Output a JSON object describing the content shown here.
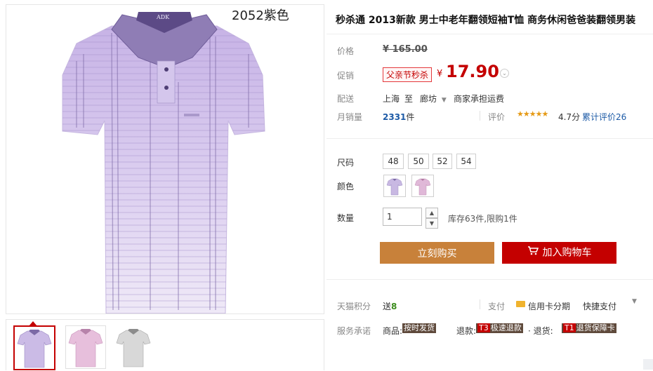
{
  "product": {
    "title": "秒杀通 2013新款 男士中老年翻领短袖T恤 商务休闲爸爸装翻领男装",
    "image_caption": "2052紫色",
    "collar_logo": "ADK"
  },
  "price": {
    "label": "价格",
    "original": "¥ 165.00"
  },
  "promo": {
    "label": "促销",
    "tag": "父亲节秒杀",
    "currency": "¥",
    "price": "17.90"
  },
  "shipping": {
    "label": "配送",
    "from": "上海",
    "to_word": "至",
    "dest": "廊坊",
    "fee": "商家承担运费"
  },
  "sales": {
    "label": "月销量",
    "count": "2331",
    "unit": "件",
    "review_label": "评价",
    "stars": "★★★★★",
    "score": "4.7分",
    "total_reviews": "累计评价26"
  },
  "sizes": {
    "label": "尺码",
    "options": [
      "48",
      "50",
      "52",
      "54"
    ]
  },
  "colors": {
    "label": "颜色",
    "swatches": [
      "#c8b8e2",
      "#e0b8d8"
    ]
  },
  "quantity": {
    "label": "数量",
    "value": "1",
    "stock": "库存63件,限购1件"
  },
  "actions": {
    "buy_now": "立刻购买",
    "add_to_cart": "加入购物车"
  },
  "points": {
    "label": "天猫积分",
    "text": "送",
    "value": "8"
  },
  "payment": {
    "label": "支付",
    "installment": "信用卡分期",
    "quick": "快捷支付"
  },
  "service": {
    "label": "服务承诺",
    "items": [
      {
        "prefix": "商品:",
        "num": "",
        "tag": "按时发货"
      },
      {
        "prefix": "退款:",
        "num": "T3",
        "tag": "极速退款"
      },
      {
        "prefix": "· 退货:",
        "num": "T1",
        "tag": "退货保障卡"
      }
    ]
  },
  "colors_theme": {
    "accent_red": "#c40000",
    "buy_orange": "#c8813a",
    "link_blue": "#1c5aa6",
    "shirt_purple": "#c9b8e6"
  }
}
